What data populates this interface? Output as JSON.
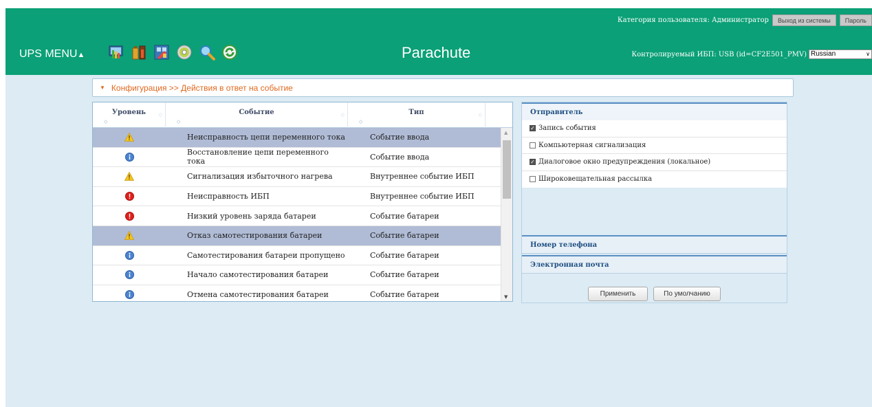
{
  "header": {
    "user_category": "Категория пользователя: Администратор",
    "logout_label": "Выход из системы",
    "password_label": "Пароль",
    "menu_label": "UPS MENU",
    "menu_caret": "▲",
    "brand": "Parachute",
    "monitored_ups": "Контролируемый ИБП: USB (id=CF2E501_PMV)",
    "language": "Russian",
    "toolbar_icons": [
      "monitor-icon",
      "battery-icon",
      "tools-icon",
      "disc-icon",
      "magnifier-icon",
      "refresh-icon"
    ]
  },
  "breadcrumb": {
    "text": "Конфигурация >> Действия в ответ на событие"
  },
  "events_table": {
    "columns": [
      "Уровень",
      "Событие",
      "Тип"
    ],
    "rows": [
      {
        "level": "warning",
        "event": "Неисправность цепи переменного тока",
        "type": "Событие ввода",
        "selected": true
      },
      {
        "level": "info",
        "event": "Восстановление цепи переменного тока",
        "type": "Событие ввода",
        "selected": false
      },
      {
        "level": "warning",
        "event": "Сигнализация избыточного нагрева",
        "type": "Внутреннее событие ИБП",
        "selected": false
      },
      {
        "level": "error",
        "event": "Неисправность ИБП",
        "type": "Внутреннее событие ИБП",
        "selected": false
      },
      {
        "level": "error",
        "event": "Низкий уровень заряда батареи",
        "type": "Событие батареи",
        "selected": false
      },
      {
        "level": "warning",
        "event": "Отказ самотестирования батареи",
        "type": "Событие батареи",
        "selected": true
      },
      {
        "level": "info",
        "event": "Самотестирования батареи пропущено",
        "type": "Событие батареи",
        "selected": false
      },
      {
        "level": "info",
        "event": "Начало самотестирования батареи",
        "type": "Событие батареи",
        "selected": false
      },
      {
        "level": "info",
        "event": "Отмена самотестирования батареи",
        "type": "Событие батареи",
        "selected": false
      }
    ]
  },
  "sender_panel": {
    "title": "Отправитель",
    "items": [
      {
        "label": "Запись события",
        "checked": true
      },
      {
        "label": "Компьютерная сигнализация",
        "checked": false
      },
      {
        "label": "Диалоговое окно предупреждения (локальное)",
        "checked": true
      },
      {
        "label": "Широковещательная рассылка",
        "checked": false
      }
    ],
    "phone_title": "Номер телефона",
    "email_title": "Электронная почта",
    "apply_label": "Применить",
    "default_label": "По умолчанию"
  },
  "colors": {
    "header_bg": "#0ba077",
    "page_bg": "#dcebf4",
    "breadcrumb_text": "#e0691f",
    "selected_row": "#b0bcd6"
  }
}
